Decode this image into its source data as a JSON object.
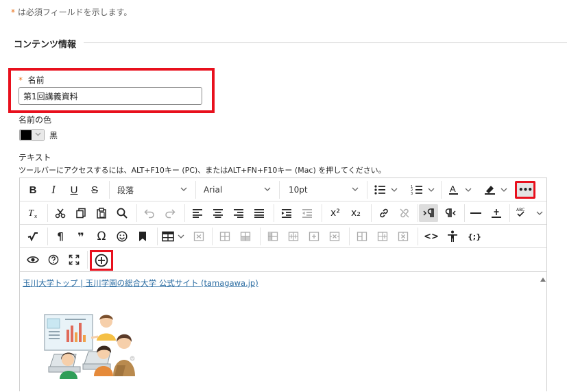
{
  "header": {
    "required_star": "*",
    "required_note": "は必須フィールドを示します。",
    "section_title": "コンテンツ情報"
  },
  "name_field": {
    "star": "*",
    "label": "名前",
    "value": "第1回講義資料"
  },
  "name_color": {
    "label": "名前の色",
    "selected": "黒",
    "swatch_color": "#000000"
  },
  "text_field": {
    "label": "テキスト",
    "toolbar_note": "ツールバーにアクセスするには、ALT+F10キー (PC)、またはALT+FN+F10キー (Mac) を押してください。"
  },
  "toolbar": {
    "bold": "B",
    "italic": "I",
    "underline": "U",
    "strike": "S",
    "paragraph": "段落",
    "font": "Arial",
    "size": "10pt",
    "more": "•••",
    "superscript": "x²",
    "subscript": "x₂",
    "pilcrow": "¶",
    "quote": "❞",
    "omega": "Ω",
    "code": "<>",
    "latex": "{;}",
    "spell": "ABC"
  },
  "content": {
    "link_text": "玉川大学トップ | 玉川学園の総合大学 公式サイト (tamagawa.jp)"
  },
  "colors": {
    "accent_red": "#e8101d",
    "required_orange": "#e8711a",
    "link_blue": "#2d6ea3"
  }
}
